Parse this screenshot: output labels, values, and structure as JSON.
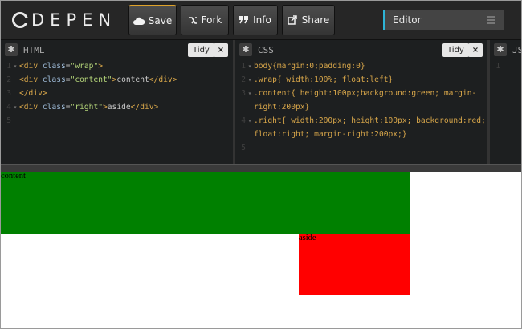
{
  "logo": {
    "text": "DEPEN"
  },
  "toolbar": {
    "save": "Save",
    "fork": "Fork",
    "info": "Info",
    "share": "Share"
  },
  "editor_view": {
    "label": "Editor"
  },
  "panes": {
    "html": {
      "title": "HTML",
      "tidy": "Tidy",
      "close": "×",
      "lines": [
        "1",
        "2",
        "3",
        "4",
        "5"
      ]
    },
    "css": {
      "title": "CSS",
      "tidy": "Tidy",
      "close": "×"
    },
    "js": {
      "title": "JS",
      "line": "1"
    }
  },
  "html_code": {
    "l1a": "<div ",
    "l1b": "class",
    "l1c": "=",
    "l1d": "\"wrap\"",
    "l1e": ">",
    "l2a": "<div ",
    "l2b": "class",
    "l2c": "=",
    "l2d": "\"content\"",
    "l2e": ">",
    "l2f": "content",
    "l2g": "</div>",
    "l3a": "</div>",
    "l4a": "<div ",
    "l4b": "class",
    "l4c": "=",
    "l4d": "\"right\"",
    "l4e": ">",
    "l4f": "aside",
    "l4g": "</div>"
  },
  "css_code": {
    "l1": "body{margin:0;padding:0}",
    "l2": ".wrap{ width:100%; float:left}",
    "l3a": ".content{ height:100px;background:green; margin-",
    "l3b": "right:200px}",
    "l4a": ".right{ width:200px; height:100px; background:red;",
    "l4b": "float:right; margin-right:200px;}"
  },
  "preview": {
    "content_text": "content",
    "aside_text": "aside"
  },
  "colors": {
    "content_bg": "#008000",
    "aside_bg": "#ff0000",
    "save_accent": "#e0a32a",
    "editor_accent": "#2eb4d6"
  }
}
